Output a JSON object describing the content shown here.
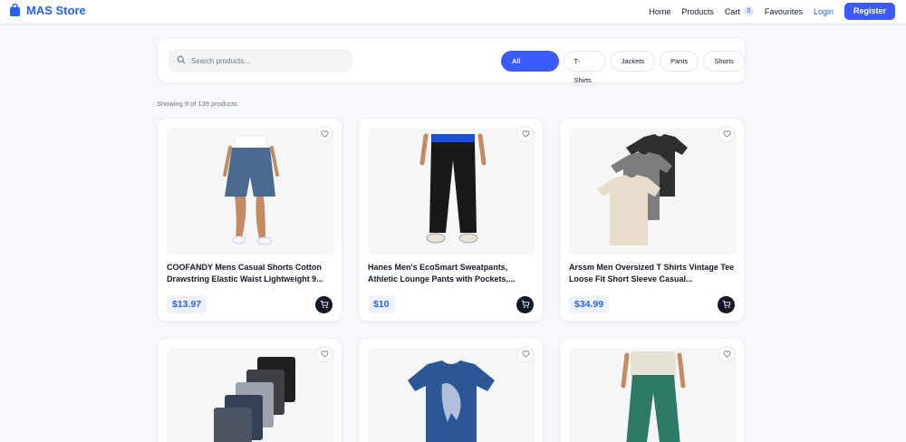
{
  "header": {
    "brand": "MAS Store",
    "nav": {
      "home": "Home",
      "products": "Products",
      "cart": "Cart",
      "cart_count": "0",
      "favourites": "Favourites",
      "login": "Login",
      "register": "Register"
    }
  },
  "filters": {
    "search_placeholder": "Search products...",
    "categories": [
      "All Products",
      "T-Shirts",
      "Jackets",
      "Pants",
      "Shorts"
    ],
    "active_category": "All Products"
  },
  "results": {
    "showing": "Showing 9 of 139 products"
  },
  "products": [
    {
      "title": "COOFANDY Mens Casual Shorts Cotton Drawstring Elastic Waist Lightweight 9...",
      "price": "$13.97"
    },
    {
      "title": "Hanes Men's EcoSmart Sweatpants, Athletic Lounge Pants with Pockets,...",
      "price": "$10"
    },
    {
      "title": "Arssm Men Oversized T Shirts Vintage Tee Loose Fit Short Sleeve Casual...",
      "price": "$34.99"
    },
    {
      "title": "",
      "price": ""
    },
    {
      "title": "",
      "price": ""
    },
    {
      "title": "",
      "price": ""
    }
  ],
  "colors": {
    "accent": "#3b5bfd",
    "brand": "#2563eb",
    "dark": "#111827"
  }
}
